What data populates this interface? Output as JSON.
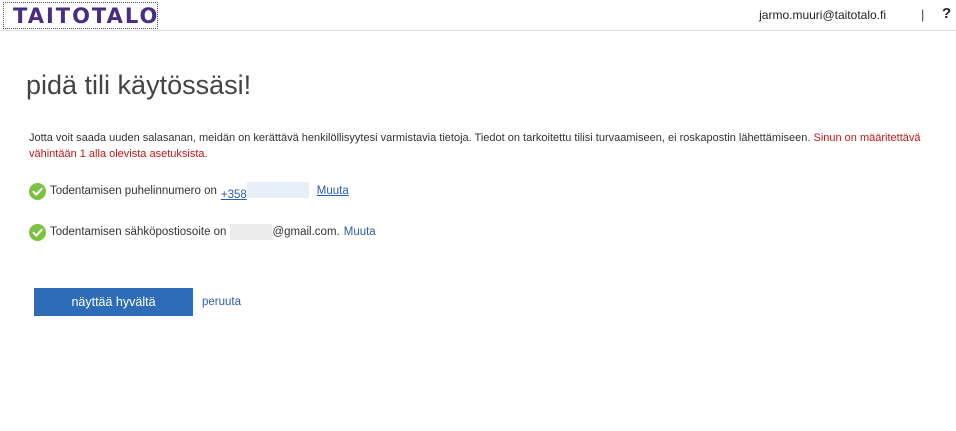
{
  "header": {
    "logo_text": "TAITOTALO",
    "user_email": "jarmo.muuri@taitotalo.fi",
    "separator": "|",
    "help_label": "?"
  },
  "page": {
    "title": "pidä tili käytössäsi!",
    "intro_text": "Jotta voit saada uuden salasanan, meidän on kerättävä henkilöllisyytesi varmistavia tietoja. Tiedot on tarkoitettu tilisi turvaamiseen, ei roskapostin lähettämiseen.",
    "intro_warning": "Sinun on määritettävä vähintään 1 alla olevista asetuksista."
  },
  "verification": {
    "phone": {
      "label": "Todentamisen puhelinnumero on",
      "value_prefix": "+358",
      "change_label": "Muuta",
      "status_icon": "check-circle-icon"
    },
    "email": {
      "label": "Todentamisen sähköpostiosoite on",
      "value_domain": "@gmail.com.",
      "change_label": "Muuta",
      "status_icon": "check-circle-icon"
    }
  },
  "actions": {
    "confirm_label": "näyttää hyvältä",
    "cancel_label": "peruuta"
  },
  "colors": {
    "brand": "#4a2c82",
    "primary_button": "#2d6db8",
    "link": "#2a5db0",
    "warning": "#c01818",
    "success": "#7cc242"
  }
}
